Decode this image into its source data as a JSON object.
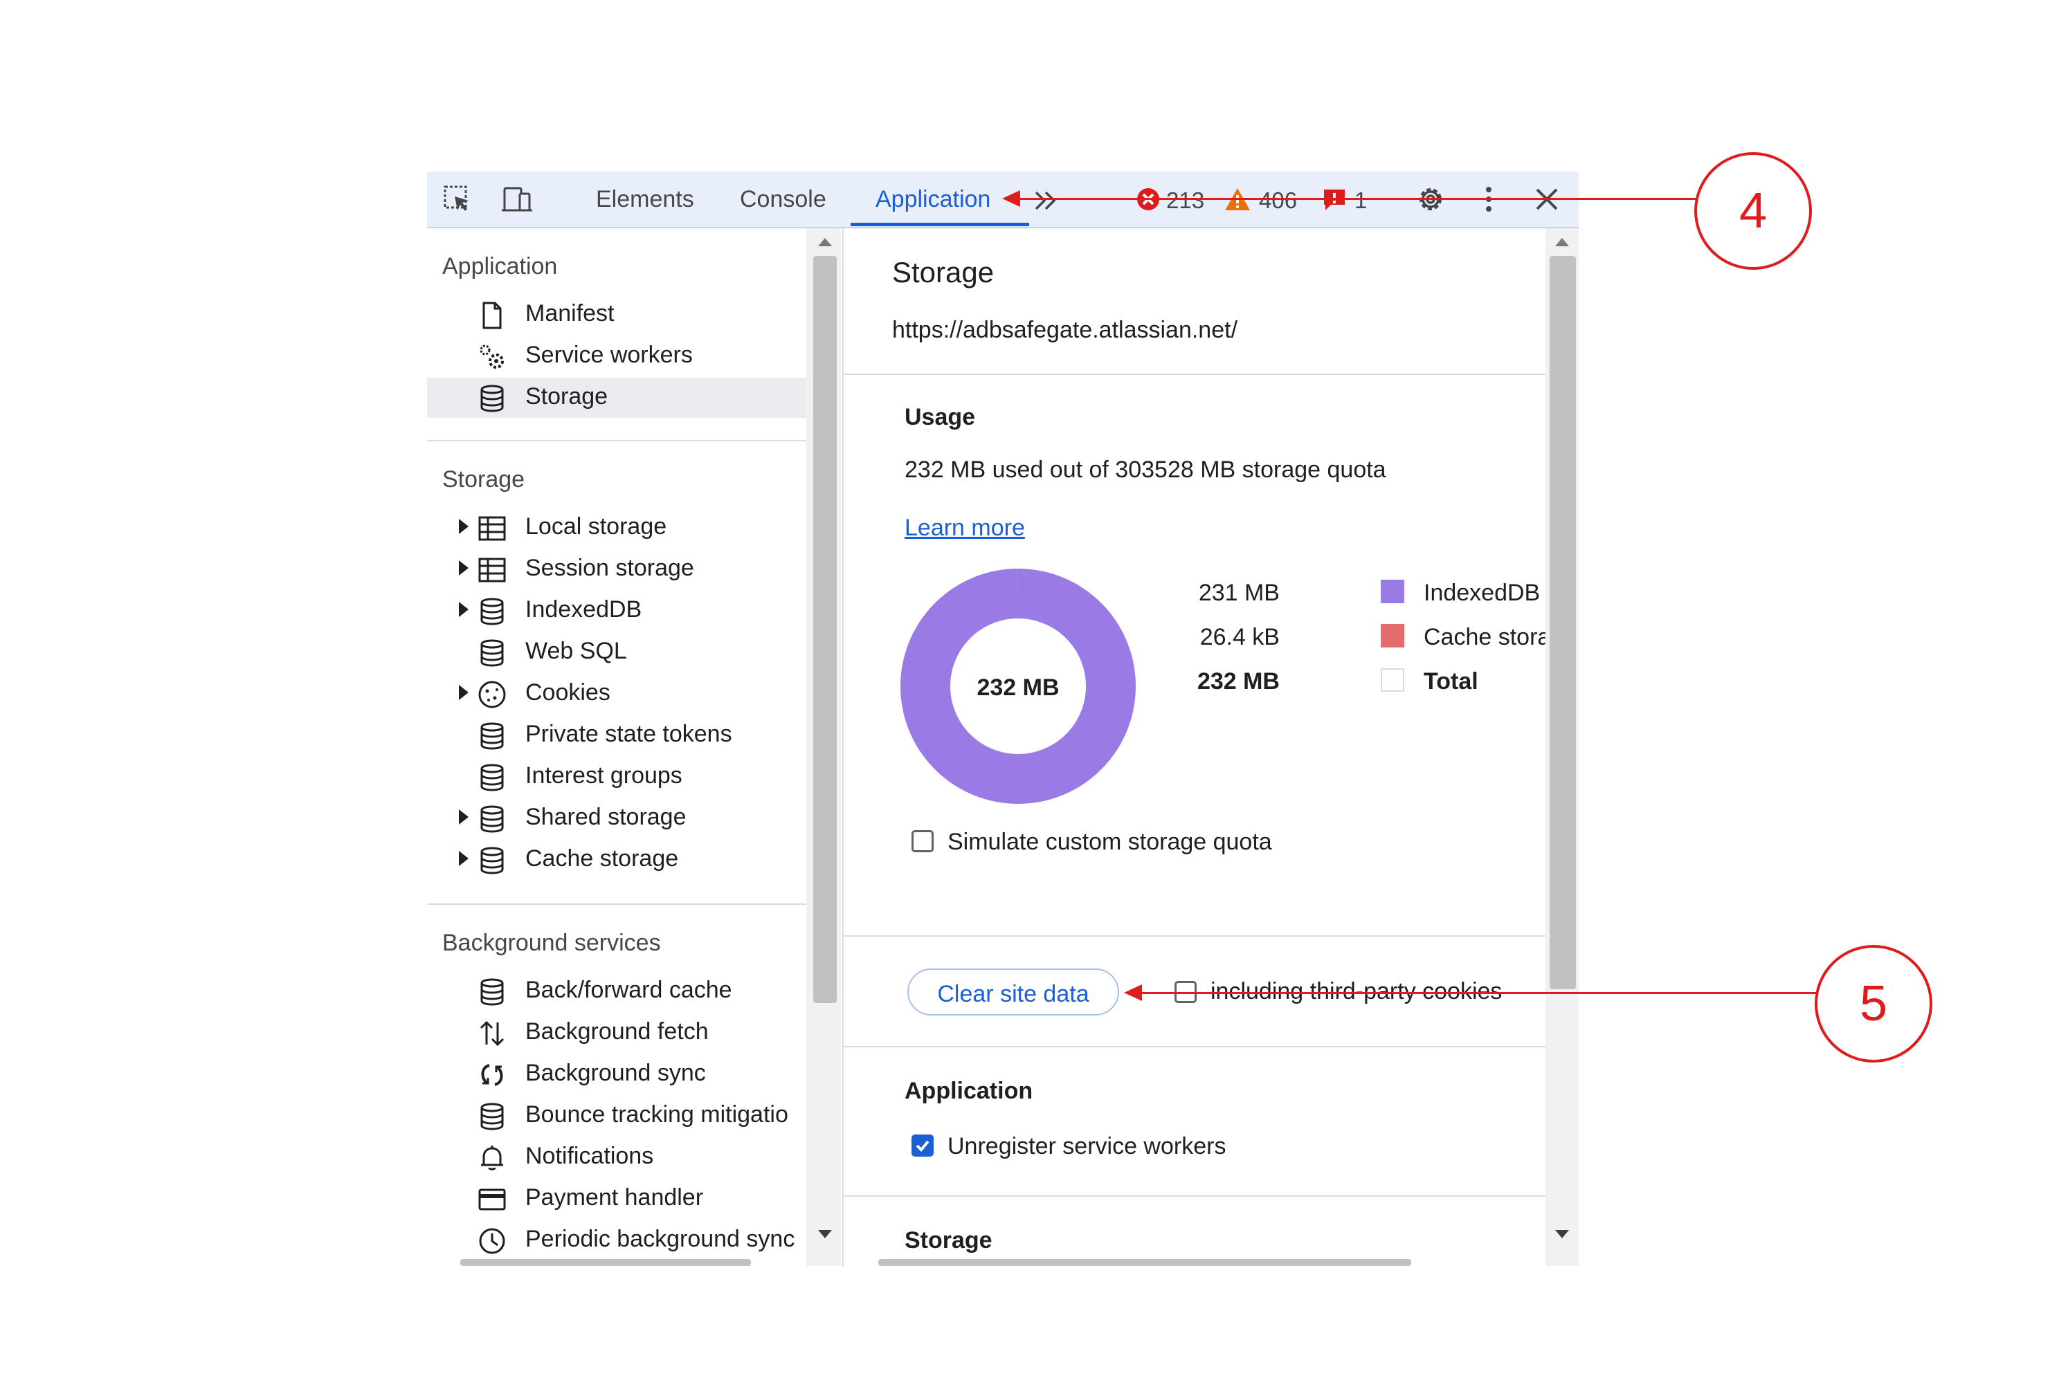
{
  "toolbar": {
    "tabs": [
      {
        "label": "Elements"
      },
      {
        "label": "Console"
      },
      {
        "label": "Application",
        "active": true
      }
    ],
    "errors_count": "213",
    "warnings_count": "406",
    "issues_count": "1"
  },
  "sidebar": {
    "sections": [
      {
        "title": "Application",
        "items": [
          {
            "label": "Manifest",
            "icon": "document-icon"
          },
          {
            "label": "Service workers",
            "icon": "gears-icon"
          },
          {
            "label": "Storage",
            "icon": "database-icon",
            "selected": true
          }
        ]
      },
      {
        "title": "Storage",
        "items": [
          {
            "label": "Local storage",
            "icon": "table-icon",
            "expandable": true
          },
          {
            "label": "Session storage",
            "icon": "table-icon",
            "expandable": true
          },
          {
            "label": "IndexedDB",
            "icon": "database-icon",
            "expandable": true
          },
          {
            "label": "Web SQL",
            "icon": "database-icon"
          },
          {
            "label": "Cookies",
            "icon": "cookie-icon",
            "expandable": true
          },
          {
            "label": "Private state tokens",
            "icon": "database-icon"
          },
          {
            "label": "Interest groups",
            "icon": "database-icon"
          },
          {
            "label": "Shared storage",
            "icon": "database-icon",
            "expandable": true
          },
          {
            "label": "Cache storage",
            "icon": "database-icon",
            "expandable": true
          }
        ]
      },
      {
        "title": "Background services",
        "items": [
          {
            "label": "Back/forward cache",
            "icon": "database-icon"
          },
          {
            "label": "Background fetch",
            "icon": "up-down-arrows-icon"
          },
          {
            "label": "Background sync",
            "icon": "sync-icon"
          },
          {
            "label": "Bounce tracking mitigatio",
            "icon": "database-icon"
          },
          {
            "label": "Notifications",
            "icon": "bell-icon"
          },
          {
            "label": "Payment handler",
            "icon": "card-icon"
          },
          {
            "label": "Periodic background sync",
            "icon": "clock-icon"
          }
        ]
      }
    ]
  },
  "main": {
    "title": "Storage",
    "origin": "https://adbsafegate.atlassian.net/",
    "usage": {
      "heading": "Usage",
      "summary": "232 MB used out of 303528 MB storage quota",
      "learn_more": "Learn more",
      "total_label": "232 MB",
      "simulate_label": "Simulate custom storage quota",
      "simulate_checked": false
    },
    "legend": [
      {
        "value": "231 MB",
        "name": "IndexedDB",
        "color": "#9a7be6"
      },
      {
        "value": "26.4 kB",
        "name": "Cache storag",
        "color": "#e56c6c"
      },
      {
        "value": "232 MB",
        "name": "Total",
        "color": "#ffffff",
        "bold": true
      }
    ],
    "clear": {
      "button": "Clear site data",
      "third_party_label": "including third-party cookies",
      "third_party_checked": false
    },
    "application_section": {
      "heading": "Application",
      "unregister_label": "Unregister service workers",
      "unregister_checked": true
    },
    "storage_section": {
      "heading": "Storage"
    }
  },
  "chart_data": {
    "type": "pie",
    "categories": [
      "IndexedDB",
      "Cache storag"
    ],
    "values": [
      231,
      0.0264
    ],
    "unit": "MB",
    "center_label": "232 MB",
    "colors": [
      "#9a7be6",
      "#e56c6c"
    ]
  },
  "annotations": {
    "callout_4": "4",
    "callout_5": "5"
  }
}
